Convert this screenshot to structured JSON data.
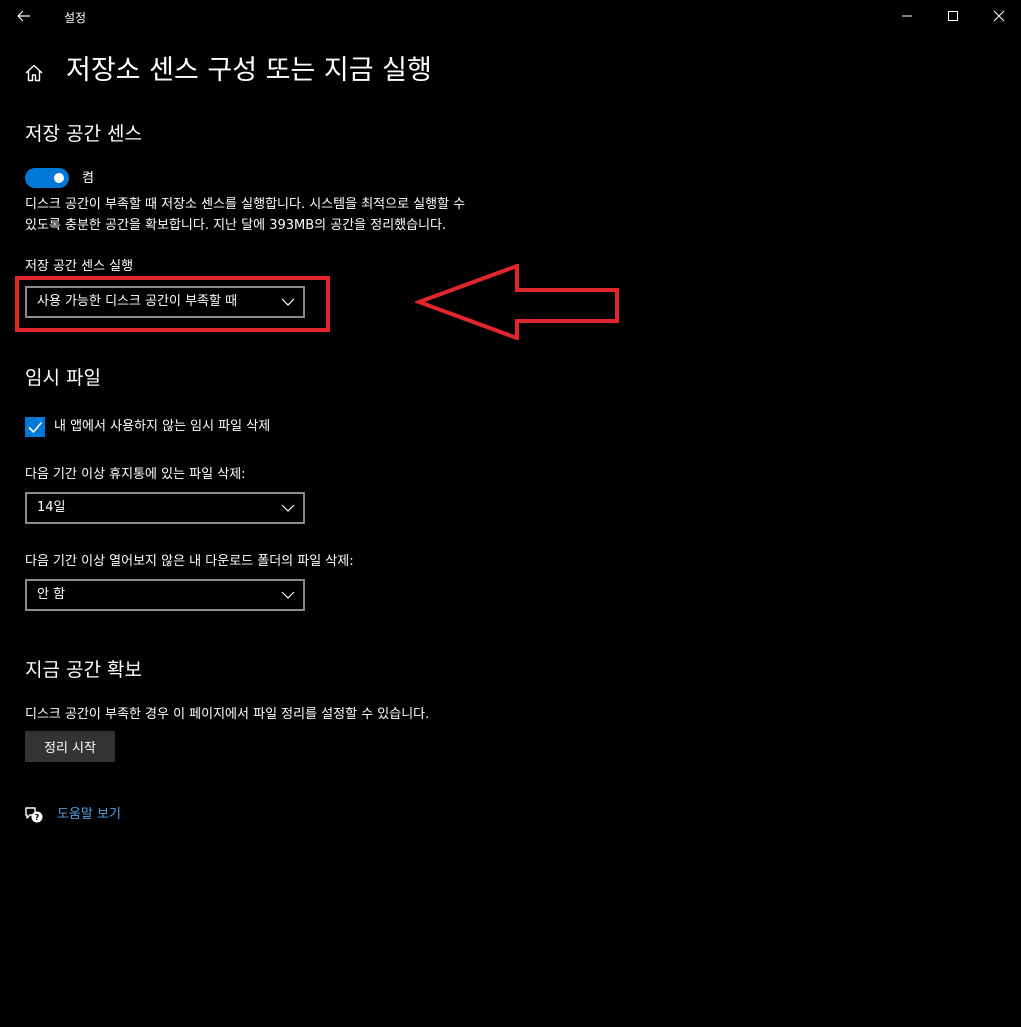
{
  "window": {
    "title": "설정",
    "back_icon": "back-arrow-icon",
    "controls": [
      "minimize-icon",
      "maximize-icon",
      "close-icon"
    ]
  },
  "page": {
    "title": "저장소 센스 구성 또는 지금 실행",
    "home_icon": "home-icon"
  },
  "storage_sense": {
    "heading": "저장 공간 센스",
    "toggle": {
      "state": "on",
      "label": "켬",
      "color": "#0078d7"
    },
    "description": "디스크 공간이 부족할 때 저장소 센스를 실행합니다. 시스템을 최적으로 실행할 수 있도록 충분한 공간을 확보합니다. 지난 달에 393MB의 공간을 정리했습니다.",
    "run_label": "저장 공간 센스 실행",
    "run_dropdown_value": "사용 가능한 디스크 공간이 부족할 때"
  },
  "temp_files": {
    "heading": "임시 파일",
    "checkbox": {
      "checked": true,
      "label": "내 앱에서 사용하지 않는 임시 파일 삭제"
    },
    "recycle_label": "다음 기간 이상 휴지통에 있는 파일 삭제:",
    "recycle_value": "14일",
    "downloads_label": "다음 기간 이상 열어보지 않은 내 다운로드 폴더의 파일 삭제:",
    "downloads_value": "안 함"
  },
  "free_space": {
    "heading": "지금 공간 확보",
    "description": "디스크 공간이 부족한 경우 이 페이지에서 파일 정리를 설정할 수 있습니다.",
    "button_label": "정리 시작"
  },
  "help": {
    "icon": "help-chat-icon",
    "link_text": "도움말 보기",
    "color": "#4ea1e8"
  },
  "annotation": {
    "color": "#e0252c",
    "shapes": [
      "highlight-box",
      "left-arrow"
    ]
  }
}
